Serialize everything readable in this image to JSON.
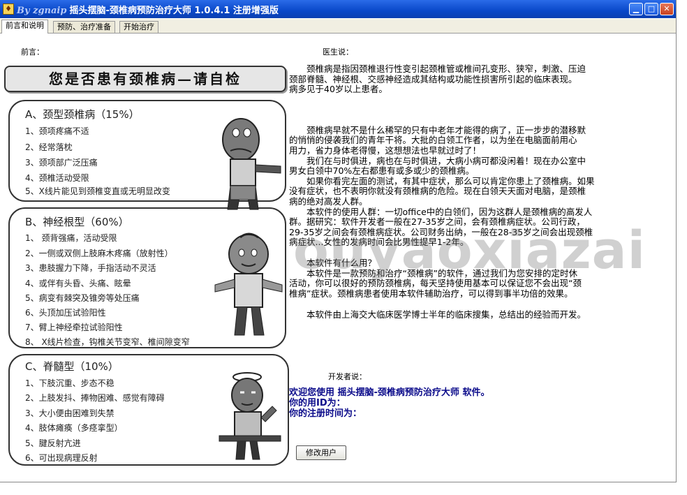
{
  "window": {
    "title_prefix": "By zgnaip",
    "title": "摇头摆脑-颈椎病预防治疗大师 1.0.4.1 注册增强版"
  },
  "tabs": [
    {
      "label": "前言和说明",
      "active": true
    },
    {
      "label": "预防、治疗准备",
      "active": false
    },
    {
      "label": "开始治疗",
      "active": false
    }
  ],
  "preface": {
    "label": "前言：",
    "headline": "您是否患有颈椎病—请自检",
    "sections": [
      {
        "title": "A、颈型颈椎病（15%）",
        "items": [
          "1、颈项疼痛不适",
          "2、经常落枕",
          "3、颈项部广泛压痛",
          "4、颈椎活动受限",
          "5、X线片能见到颈椎变直或无明显改变"
        ]
      },
      {
        "title": "B、神经根型（60%）",
        "items": [
          "1、 颈背强痛，活动受限",
          "2、一侧或双侧上肢麻木疼痛（放射性）",
          "3、患肢握力下降，手指活动不灵活",
          "4、或伴有头昏、头痛、眩晕",
          "5、病变有棘突及锥旁等处压痛",
          "6、头顶加压试验阳性",
          "7、臂上神经牵拉试验阳性",
          "8、 X线片检查，钩椎关节变窄、椎间隙变窄"
        ]
      },
      {
        "title": "C、脊髓型（10%）",
        "items": [
          "1、下肢沉重、步态不稳",
          "2、上肢发抖、捧物困难、感觉有障碍",
          "3、大小便由困难到失禁",
          "4、肢体瘫痪（多痉挛型）",
          "5、腱反射亢进",
          "6、可出现病理反射"
        ]
      }
    ]
  },
  "doctor": {
    "label": "医生说：",
    "paragraphs": [
      [
        "　　颈椎病是指因颈椎退行性变引起颈椎管或椎间孔变形、狭窄，刺激、压迫",
        "颈部脊髓、神经根、交感神经造成其结构或功能性损害所引起的临床表现。",
        "病多见于40岁以上患者。"
      ],
      [
        "　　颈椎病早就不是什么稀罕的只有中老年才能得的病了，正一步步的潜移默",
        "的悄悄的侵袭我们的青年干将。大批的白领工作者，以为坐在电脑面前用心",
        "用力，省力身体老得慢，这想想法也早就过时了！",
        "　　我们在与时俱进，病也在与时俱进，大病小病可都没闲着！现在办公室中",
        "男女白领中70%左右都患有或多或少的颈椎病。",
        "　　如果你看完左面的测试，有其中症状，那么可以肯定你患上了颈椎病。如果",
        "没有症状，也不表明你就没有颈椎病的危险。现在白领天天面对电脑，是颈椎",
        "病的绝对高发人群。",
        "　　本软件的使用人群：一切office中的白领们，因为这群人是颈椎病的高发人",
        "群。据研究：软件开发者一般在27-35岁之间，会有颈椎病症状。公司行政，",
        "29-35岁之间会有颈椎病症状。公司财务出纳，一般在28-35岁之间会出现颈椎",
        "病症状...女性的发病时间会比男性提早1-2年。"
      ],
      [
        "　　本软件有什么用？",
        "　　本软件是一款预防和治疗“颈椎病”的软件，通过我们为您安排的定时休",
        "活动，你可以很好的预防颈椎病，每天坚持使用基本可以保证您不会出现“颈",
        "椎病”症状。颈椎病患者使用本软件辅助治疗，可以得到事半功倍的效果。"
      ],
      [
        "　　本软件由上海交大临床医学博士半年的临床搜集，总结出的经验而开发。"
      ]
    ]
  },
  "developer": {
    "label": "开发者说：",
    "lines": [
      "欢迎您使用 摇头摆脑-颈椎病预防治疗大师 软件。",
      "你的用ID为：",
      "你的注册时间为："
    ]
  },
  "buttons": {
    "modify_user": "修改用户"
  },
  "watermark": "ouyaoxiazai",
  "icons": {
    "app": "app-icon",
    "minimize": "minimize-icon",
    "maximize": "maximize-icon",
    "close": "close-icon"
  }
}
